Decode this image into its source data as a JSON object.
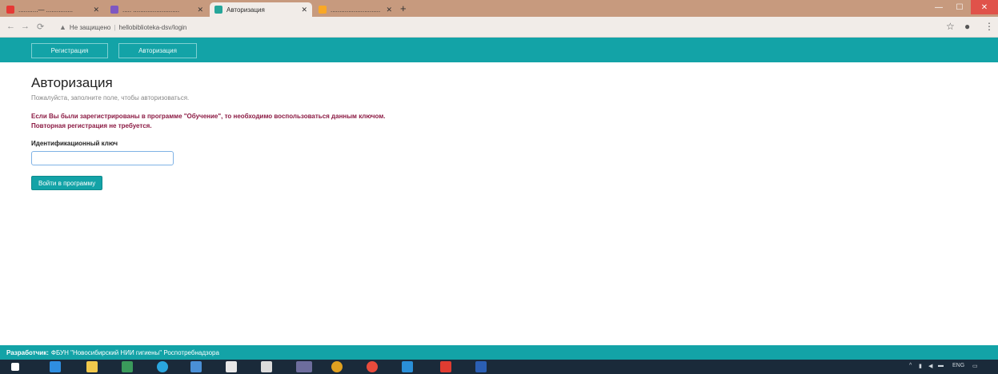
{
  "browser": {
    "tabs": [
      {
        "title": "...........— ...............",
        "active": false,
        "favicon_color": "#e53935"
      },
      {
        "title": "..... ..........................",
        "active": false,
        "favicon_color": "#7e57c2"
      },
      {
        "title": "Авторизация",
        "active": true,
        "favicon_color": "#26a69a"
      },
      {
        "title": "............................",
        "active": false,
        "favicon_color": "#f9a825"
      }
    ],
    "new_tab_glyph": "+",
    "window_controls": {
      "minimize": "—",
      "maximize": "☐",
      "close": "✕"
    },
    "nav": {
      "back": "←",
      "forward": "→",
      "reload": "⟳"
    },
    "address": {
      "security_icon": "warning-icon",
      "security_label": "Не защищено",
      "url": "hellobiblioteka-dsv/login"
    },
    "toolbar_icons": {
      "star": "☆",
      "profile": "●",
      "menu": "⋮"
    }
  },
  "site_nav": {
    "links": [
      {
        "label": "Регистрация"
      },
      {
        "label": "Авторизация"
      }
    ]
  },
  "content": {
    "title": "Авторизация",
    "hint": "Пожалуйста, заполните поле, чтобы авторизоваться.",
    "notice_line1": "Если Вы были зарегистрированы в программе \"Обучение\", то необходимо воспользоваться данным ключом.",
    "notice_line2": "Повторная регистрация не требуется.",
    "key_label": "Идентификационный ключ",
    "key_value": "",
    "key_placeholder": "",
    "submit_label": "Войти в программу"
  },
  "footer": {
    "developer_label": "Разработчик:",
    "developer_text": "ФБУН \"Новосибирский НИИ гигиены\" Роспотребнадзора"
  },
  "taskbar": {
    "apps": [
      {
        "name": "start",
        "color": "#ffffff"
      },
      {
        "name": "edge",
        "color": "#2f8ee0"
      },
      {
        "name": "explorer",
        "color": "#f2c94c"
      },
      {
        "name": "store",
        "color": "#3a9a5b"
      },
      {
        "name": "skype",
        "color": "#2aa6de"
      },
      {
        "name": "monitor",
        "color": "#4a8fd6"
      },
      {
        "name": "doc",
        "color": "#e8e8e8"
      },
      {
        "name": "home",
        "color": "#dcdcdc"
      },
      {
        "name": "mail",
        "color": "#6d6d9d"
      },
      {
        "name": "media",
        "color": "#e0a020"
      },
      {
        "name": "chrome",
        "color": "#e94b3c"
      },
      {
        "name": "files",
        "color": "#2a8fd8"
      },
      {
        "name": "pdf",
        "color": "#e03c31"
      },
      {
        "name": "word",
        "color": "#2b5fb4"
      }
    ],
    "clock": "ENG"
  }
}
